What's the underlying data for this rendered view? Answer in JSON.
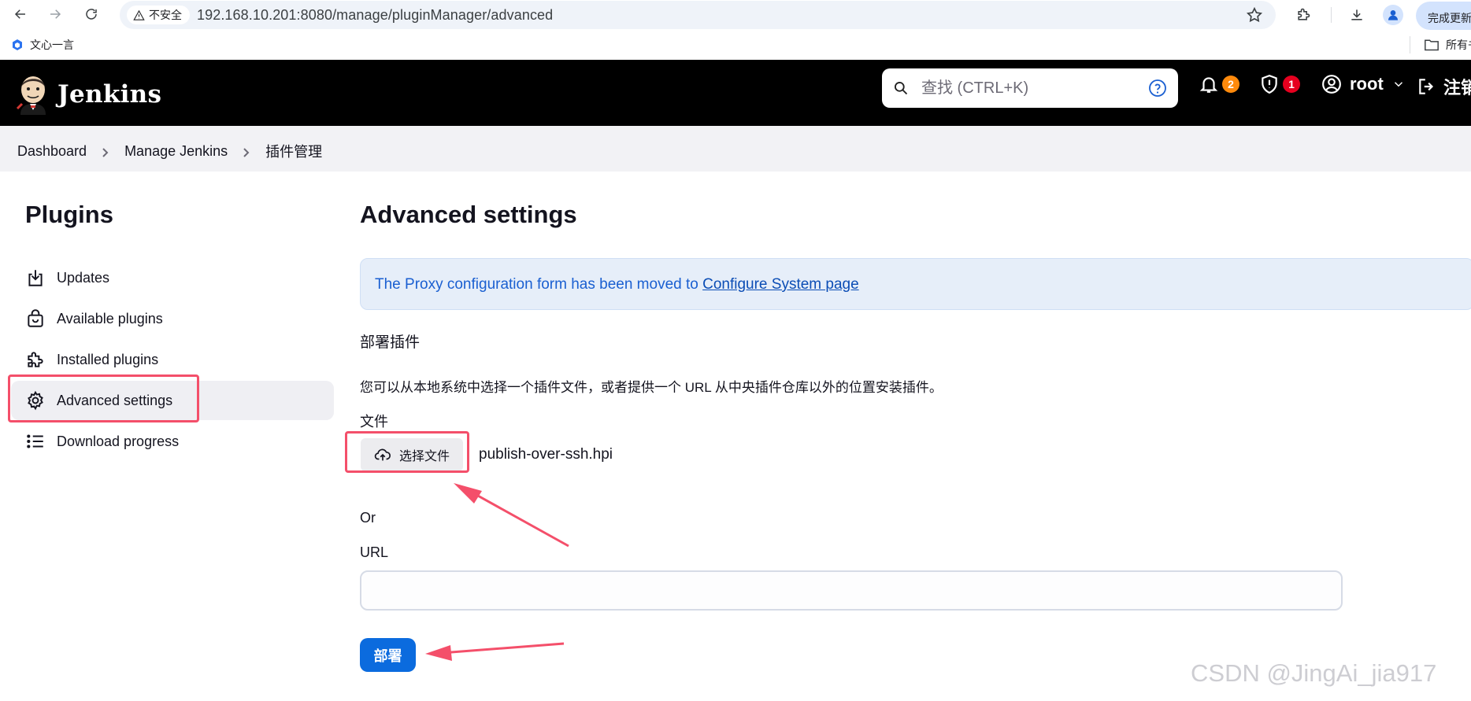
{
  "browser": {
    "security_label": "不安全",
    "url": "192.168.10.201:8080/manage/pluginManager/advanced",
    "update_button": "完成更新",
    "bookmark_item": "文心一言",
    "bookmarks_folder": "所有书签"
  },
  "header": {
    "brand": "Jenkins",
    "search_placeholder": "查找 (CTRL+K)",
    "notifications_count": "2",
    "security_count": "1",
    "user": "root",
    "logout": "注销"
  },
  "breadcrumb": [
    "Dashboard",
    "Manage Jenkins",
    "插件管理"
  ],
  "sidebar": {
    "title": "Plugins",
    "items": [
      {
        "label": "Updates",
        "icon": "download-icon"
      },
      {
        "label": "Available plugins",
        "icon": "shopping-bag-icon"
      },
      {
        "label": "Installed plugins",
        "icon": "puzzle-icon"
      },
      {
        "label": "Advanced settings",
        "icon": "gear-icon",
        "active": true
      },
      {
        "label": "Download progress",
        "icon": "list-icon"
      }
    ]
  },
  "main": {
    "title": "Advanced settings",
    "notice_text": "The Proxy configuration form has been moved to ",
    "notice_link": "Configure System page",
    "section": "部署插件",
    "description": "您可以从本地系统中选择一个插件文件，或者提供一个 URL 从中央插件仓库以外的位置安装插件。",
    "file_label": "文件",
    "choose_file_button": "选择文件",
    "selected_file": "publish-over-ssh.hpi",
    "or_label": "Or",
    "url_label": "URL",
    "url_value": "",
    "deploy_button": "部署"
  },
  "annotation_color": "#f44f6a",
  "watermark": "CSDN @JingAi_jia917"
}
